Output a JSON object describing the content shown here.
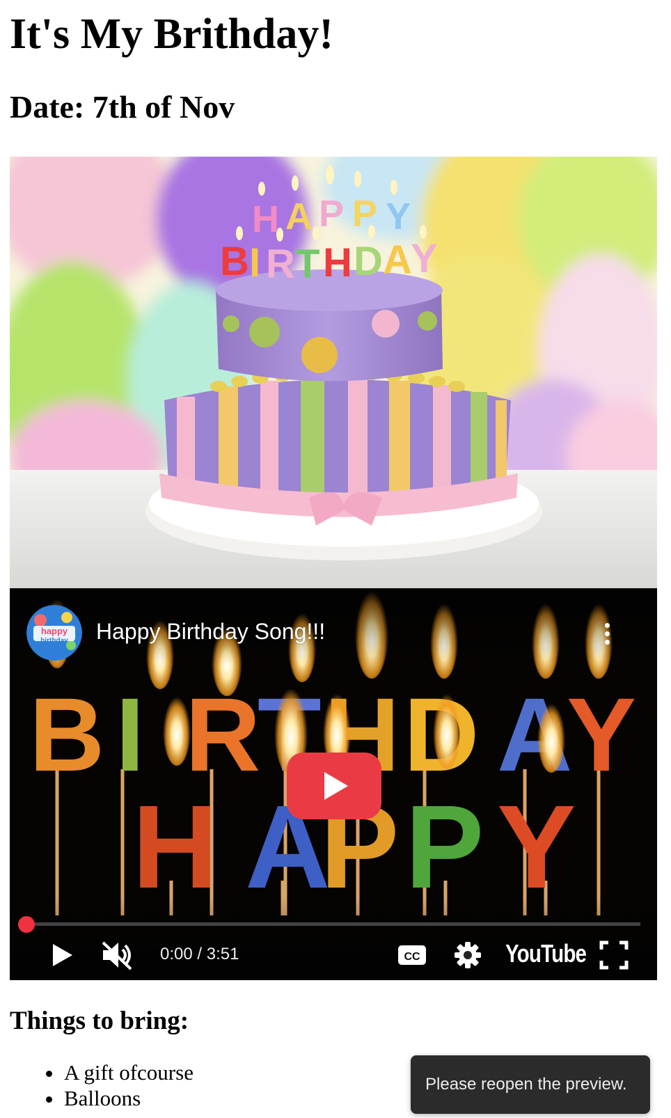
{
  "page": {
    "title": "It's My Brithday!",
    "date": "Date: 7th of Nov"
  },
  "cake_image": {
    "candle_letters_top": [
      "H",
      "A",
      "P",
      "P",
      "Y"
    ],
    "candle_letters_bottom": [
      "B",
      "I",
      "R",
      "T",
      "H",
      "D",
      "A",
      "Y"
    ],
    "colors": {
      "background": "#f5f0d8",
      "cake_top": "#a98fd2",
      "cake_bottom": "#9a82d0",
      "ribbon": "#f6bcd0",
      "stripe_yellow": "#f2c86a",
      "stripe_green": "#a9cc6c"
    }
  },
  "video": {
    "title": "Happy Birthday Song!!!",
    "channel_avatar_text_1": "happy",
    "channel_avatar_text_2": "birthday",
    "candle_word_top": [
      "B",
      "I",
      "R",
      "T",
      "H",
      "D",
      "A",
      "Y"
    ],
    "candle_word_bottom": [
      "H",
      "A",
      "P",
      "P",
      "Y"
    ],
    "time": "0:00 / 3:51",
    "progress": 0,
    "brand": "YouTube",
    "icons": {
      "play": "play-icon",
      "mute": "volume-muted-icon",
      "captions": "captions-icon",
      "settings": "gear-icon",
      "fullscreen": "fullscreen-icon",
      "more": "more-vertical-icon"
    },
    "colors": {
      "play_button": "#ea3b45",
      "progress": "#f0313f"
    }
  },
  "list": {
    "heading": "Things to bring:",
    "items": [
      "A gift ofcourse",
      "Balloons"
    ]
  },
  "toast": {
    "message": "Please reopen the preview."
  }
}
